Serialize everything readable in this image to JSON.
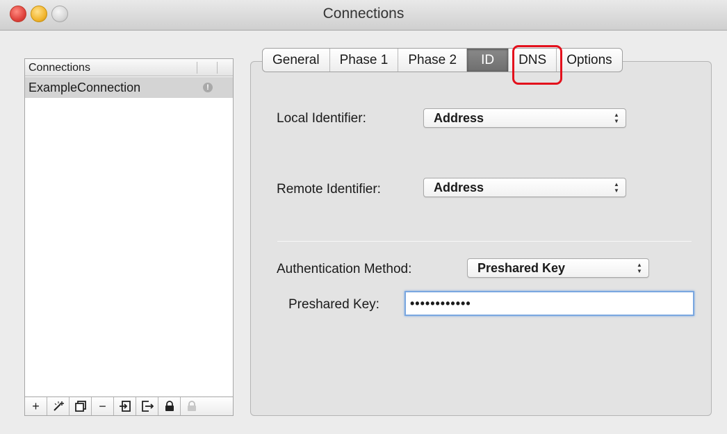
{
  "window": {
    "title": "Connections"
  },
  "sidebar": {
    "header": "Connections",
    "connections": [
      {
        "name": "ExampleConnection",
        "status_icon": "info-icon"
      }
    ],
    "toolbar": [
      {
        "icon": "add-icon",
        "glyph": "+"
      },
      {
        "icon": "wizard-icon",
        "glyph": ""
      },
      {
        "icon": "duplicate-icon",
        "glyph": ""
      },
      {
        "icon": "remove-icon",
        "glyph": "−"
      },
      {
        "icon": "import-icon",
        "glyph": ""
      },
      {
        "icon": "export-icon",
        "glyph": ""
      },
      {
        "icon": "lock-icon",
        "glyph": ""
      },
      {
        "icon": "unlock-icon",
        "glyph": ""
      }
    ]
  },
  "tabs": [
    {
      "label": "General"
    },
    {
      "label": "Phase 1"
    },
    {
      "label": "Phase 2"
    },
    {
      "label": "ID",
      "active": true
    },
    {
      "label": "DNS"
    },
    {
      "label": "Options"
    }
  ],
  "id_tab": {
    "local_identifier_label": "Local Identifier:",
    "local_identifier_value": "Address",
    "remote_identifier_label": "Remote Identifier:",
    "remote_identifier_value": "Address",
    "auth_method_label": "Authentication Method:",
    "auth_method_value": "Preshared Key",
    "preshared_key_label": "Preshared Key:",
    "preshared_key_value": "••••••••••••"
  },
  "colors": {
    "highlight": "#e3101c",
    "focus_ring": "#7aa7e0"
  }
}
